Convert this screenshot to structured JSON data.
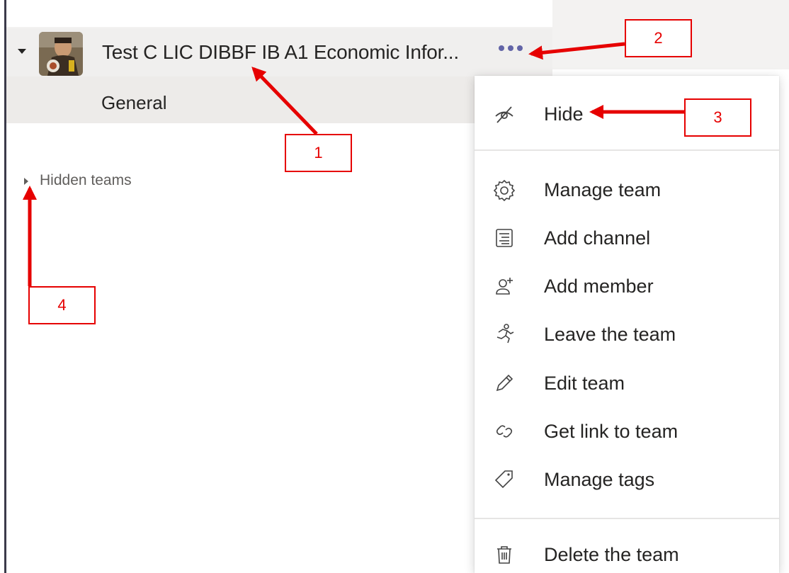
{
  "team": {
    "name": "Test C LIC DIBBF IB A1 Economic Infor...",
    "more_options": "More options"
  },
  "channel": {
    "name": "General"
  },
  "hidden_teams": {
    "label": "Hidden teams"
  },
  "menu": {
    "items": [
      {
        "label": "Hide",
        "icon": "hide-icon"
      },
      {
        "label": "Manage team",
        "icon": "gear-icon"
      },
      {
        "label": "Add channel",
        "icon": "channel-list-icon"
      },
      {
        "label": "Add member",
        "icon": "add-person-icon"
      },
      {
        "label": "Leave the team",
        "icon": "leave-runner-icon"
      },
      {
        "label": "Edit team",
        "icon": "pencil-icon"
      },
      {
        "label": "Get link to team",
        "icon": "link-icon"
      },
      {
        "label": "Manage tags",
        "icon": "tag-icon"
      },
      {
        "label": "Delete the team",
        "icon": "trash-icon"
      }
    ]
  },
  "callouts": {
    "one": "1",
    "two": "2",
    "three": "3",
    "four": "4"
  },
  "colors": {
    "accent": "#6264a7",
    "annotation": "#e60000",
    "row_bg": "#f0efee",
    "text": "#252423"
  }
}
